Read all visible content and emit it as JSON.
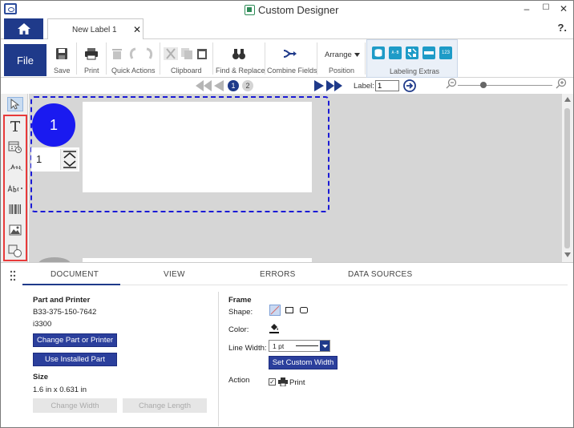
{
  "window": {
    "title": "Custom Designer",
    "minimize": "–",
    "maximize": "☐",
    "close": "✕"
  },
  "tabs": {
    "doc_tab_label": "New Label 1",
    "close": "✕",
    "help": "?."
  },
  "ribbon": {
    "file": "File",
    "save": "Save",
    "print": "Print",
    "quick_actions": "Quick Actions",
    "clipboard": "Clipboard",
    "find_replace": "Find & Replace",
    "combine_fields": "Combine Fields",
    "arrange": "Arrange",
    "position": "Position",
    "labeling_extras": "Labeling Extras",
    "extra_icons": [
      "database-icon",
      "barcode-abc-icon",
      "qr-icon",
      "serial-icon",
      "counter-123-icon"
    ],
    "counter_text": "123",
    "barcode_text": "A-B"
  },
  "nav": {
    "pages": [
      "1",
      "2"
    ],
    "label_caption": "Label:",
    "label_value": "1"
  },
  "canvas": {
    "label_number": "1",
    "copies": "1"
  },
  "panel": {
    "tabs": [
      "DOCUMENT",
      "VIEW",
      "ERRORS",
      "DATA SOURCES"
    ],
    "part_and_printer": "Part and Printer",
    "part_number": "B33-375-150-7642",
    "printer": "i3300",
    "change_part_btn": "Change Part or Printer",
    "use_installed_btn": "Use Installed Part",
    "size_heading": "Size",
    "size_value": "1.6 in x 0.631 in",
    "change_width_btn": "Change Width",
    "change_length_btn": "Change Length",
    "frame_heading": "Frame",
    "shape_label": "Shape:",
    "color_label": "Color:",
    "line_width_label": "Line Width:",
    "line_width_value": "1 pt",
    "set_custom_width_btn": "Set Custom Width",
    "action_label": "Action",
    "print_label": "Print"
  },
  "colors": {
    "accent": "#1f3a8a",
    "label_badge": "#1a1af0",
    "highlight": "#e83a3a",
    "extras_teal": "#1e9bc7"
  }
}
